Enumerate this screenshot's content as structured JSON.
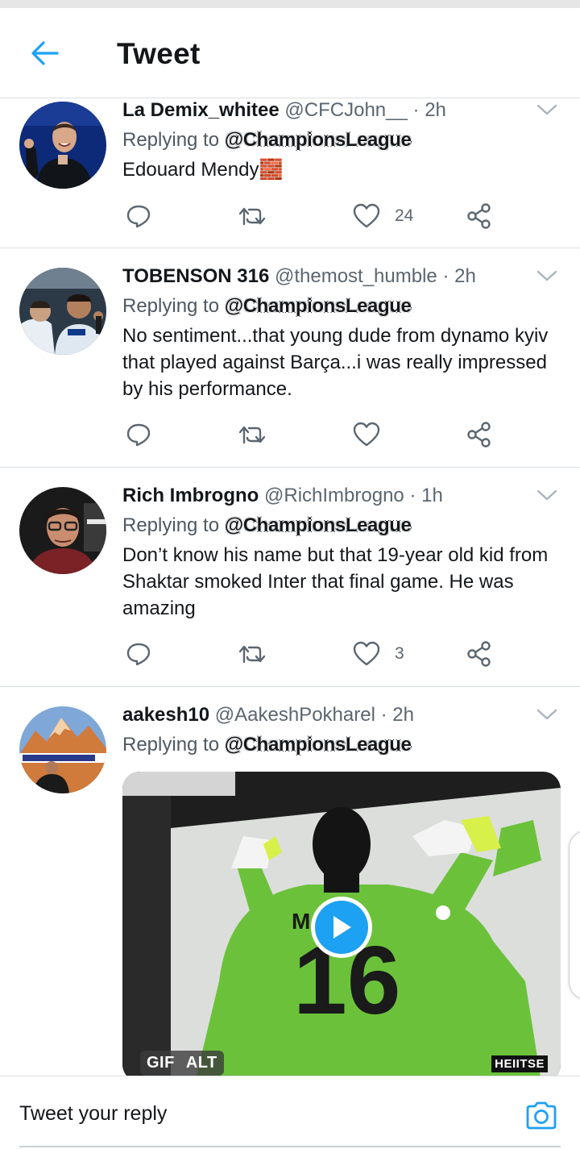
{
  "header": {
    "title": "Tweet"
  },
  "tweets": [
    {
      "name": "La Demix_whitee",
      "handle": "@CFCJohn__",
      "dot": "·",
      "time": "2h",
      "reply_prefix": "Replying to",
      "mention": "@ChampionsLeague",
      "text": "Edouard Mendy🧱",
      "like_count": "24"
    },
    {
      "name": "TOBENSON 316",
      "handle": "@themost_humble",
      "dot": "·",
      "time": "2h",
      "reply_prefix": "Replying to",
      "mention": "@ChampionsLeague",
      "text": "No sentiment...that young dude from dynamo kyiv that played against Barça...i was really impressed by his performance.",
      "like_count": ""
    },
    {
      "name": "Rich Imbrogno",
      "handle": "@RichImbrogno",
      "dot": "·",
      "time": "1h",
      "reply_prefix": "Replying to",
      "mention": "@ChampionsLeague",
      "text": "Don’t know his name but that 19-year old kid from Shaktar smoked Inter that final game. He was amazing",
      "like_count": "3"
    },
    {
      "name": "aakesh10",
      "handle": "@AakeshPokharel",
      "dot": "·",
      "time": "2h",
      "reply_prefix": "Replying to",
      "mention": "@ChampionsLeague",
      "media": {
        "badge_gif": "GIF",
        "badge_alt": "ALT",
        "watermark": "HEIITSE",
        "jersey_number": "16"
      }
    }
  ],
  "compose": {
    "placeholder": "Tweet your reply"
  },
  "colors": {
    "accent": "#1da1f2",
    "text": "#14171a",
    "secondary": "#5b6670",
    "divider": "#d9dee2"
  },
  "icons": [
    "back-arrow-icon",
    "reply-icon",
    "retweet-icon",
    "like-icon",
    "share-icon",
    "chevron-down-icon",
    "play-icon",
    "camera-icon"
  ]
}
